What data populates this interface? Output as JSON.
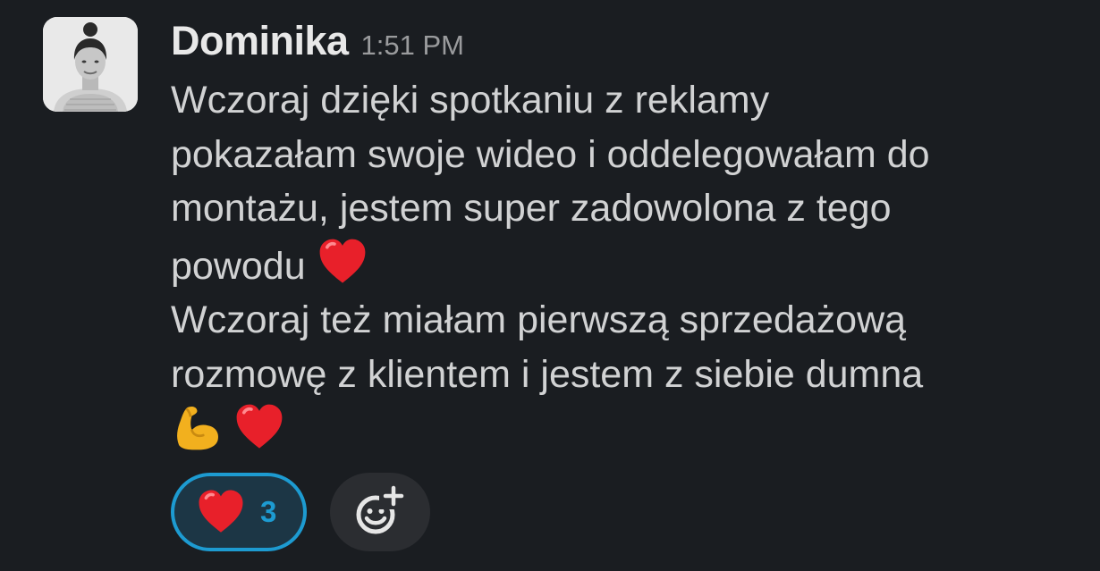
{
  "message": {
    "author": "Dominika",
    "timestamp": "1:51 PM",
    "paragraph_1": "Wczoraj dzięki spotkaniu z reklamy\npokazałam swoje wideo i oddelegowałam do\nmontażu, jestem super zadowolona z tego\npowodu",
    "paragraph_2": "Wczoraj też miałam pierwszą sprzedażową\nrozmowę z klientem i jestem z siebie dumna",
    "emoji_1": "heart-emoji",
    "emoji_2": "flexed-biceps-emoji",
    "emoji_3": "heart-emoji"
  },
  "reactions": [
    {
      "emoji": "heart-emoji",
      "count": "3",
      "active": true
    }
  ],
  "add_reaction_icon": "add-reaction-icon",
  "colors": {
    "background": "#1a1d21",
    "text": "#d1d2d3",
    "author": "#e8e8e8",
    "timestamp": "#9a9b9d",
    "reaction_active_border": "#1d9bd1",
    "reaction_active_bg": "#1c3645",
    "add_reaction_bg": "#2b2d31"
  }
}
